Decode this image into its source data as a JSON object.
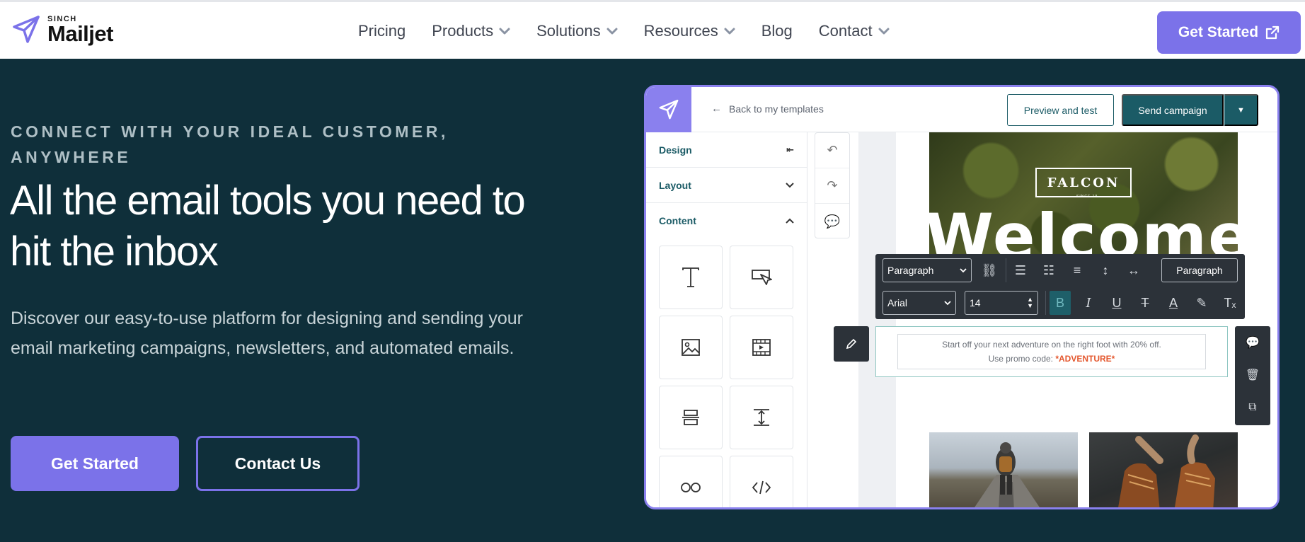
{
  "brand": {
    "sup": "SINCH",
    "name": "Mailjet",
    "accent": "#7b72e9",
    "bg": "#0f2f3a"
  },
  "nav": [
    {
      "label": "Pricing",
      "dropdown": false
    },
    {
      "label": "Products",
      "dropdown": true
    },
    {
      "label": "Solutions",
      "dropdown": true
    },
    {
      "label": "Resources",
      "dropdown": true
    },
    {
      "label": "Blog",
      "dropdown": false
    },
    {
      "label": "Contact",
      "dropdown": true
    }
  ],
  "header": {
    "cta_label": "Get Started",
    "cta_icon": "external-link-icon"
  },
  "hero": {
    "eyebrow": "CONNECT WITH YOUR IDEAL CUSTOMER, ANYWHERE",
    "headline": "All the email tools you need to hit the inbox",
    "description": "Discover our easy-to-use platform for designing and sending your email marketing campaigns, newsletters, and automated emails.",
    "primary_label": "Get Started",
    "secondary_label": "Contact Us"
  },
  "editor": {
    "back_label": "Back to my templates",
    "preview_label": "Preview and test",
    "send_label": "Send campaign",
    "sidebar": [
      {
        "label": "Design",
        "icon": "collapse-left-icon"
      },
      {
        "label": "Layout",
        "icon": "chevron-down-icon"
      },
      {
        "label": "Content",
        "icon": "chevron-up-icon"
      }
    ],
    "template": {
      "brand": "FALCON",
      "brand_sub": "SINCE 19",
      "headline": "Welcome",
      "promo_text": "Start off your next adventure on the right foot with 20% off.",
      "promo_prefix": "Use promo code: ",
      "promo_code": "*ADVENTURE*"
    },
    "toolbar": {
      "block_style": "Paragraph",
      "paragraph_button": "Paragraph",
      "font": "Arial",
      "size": "14"
    }
  }
}
